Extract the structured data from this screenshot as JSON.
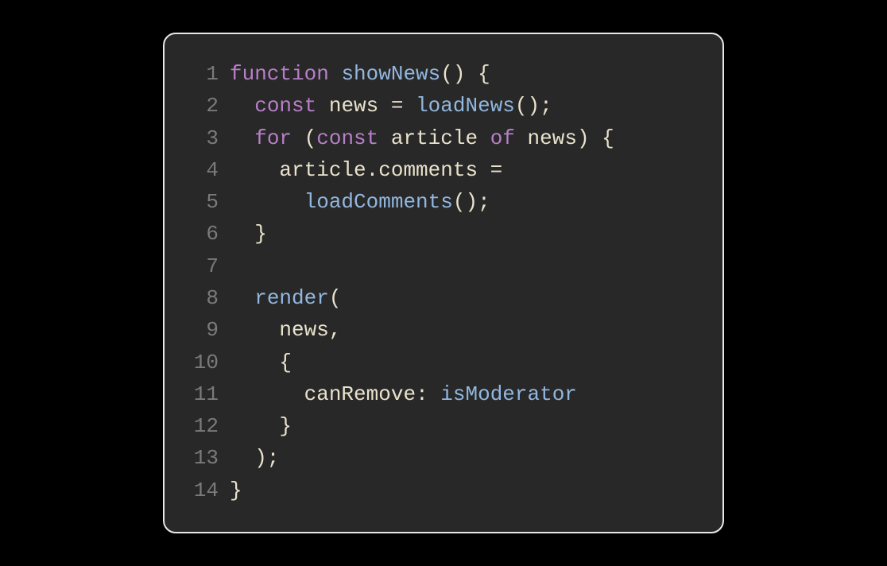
{
  "code": {
    "lines": [
      {
        "num": "1",
        "tokens": [
          {
            "cls": "tk-keyword",
            "text": "function"
          },
          {
            "cls": "tk-punc",
            "text": " "
          },
          {
            "cls": "tk-funcdef",
            "text": "showNews"
          },
          {
            "cls": "tk-punc",
            "text": "() {"
          }
        ]
      },
      {
        "num": "2",
        "tokens": [
          {
            "cls": "tk-punc",
            "text": "  "
          },
          {
            "cls": "tk-keyword",
            "text": "const"
          },
          {
            "cls": "tk-punc",
            "text": " "
          },
          {
            "cls": "tk-var",
            "text": "news"
          },
          {
            "cls": "tk-punc",
            "text": " = "
          },
          {
            "cls": "tk-funccall",
            "text": "loadNews"
          },
          {
            "cls": "tk-punc",
            "text": "();"
          }
        ]
      },
      {
        "num": "3",
        "tokens": [
          {
            "cls": "tk-punc",
            "text": "  "
          },
          {
            "cls": "tk-keyword",
            "text": "for"
          },
          {
            "cls": "tk-punc",
            "text": " ("
          },
          {
            "cls": "tk-keyword",
            "text": "const"
          },
          {
            "cls": "tk-punc",
            "text": " "
          },
          {
            "cls": "tk-var",
            "text": "article"
          },
          {
            "cls": "tk-punc",
            "text": " "
          },
          {
            "cls": "tk-keyword",
            "text": "of"
          },
          {
            "cls": "tk-punc",
            "text": " "
          },
          {
            "cls": "tk-var",
            "text": "news"
          },
          {
            "cls": "tk-punc",
            "text": ") {"
          }
        ]
      },
      {
        "num": "4",
        "tokens": [
          {
            "cls": "tk-punc",
            "text": "    "
          },
          {
            "cls": "tk-var",
            "text": "article"
          },
          {
            "cls": "tk-punc",
            "text": "."
          },
          {
            "cls": "tk-prop",
            "text": "comments"
          },
          {
            "cls": "tk-punc",
            "text": " ="
          }
        ]
      },
      {
        "num": "5",
        "tokens": [
          {
            "cls": "tk-punc",
            "text": "      "
          },
          {
            "cls": "tk-funccall",
            "text": "loadComments"
          },
          {
            "cls": "tk-punc",
            "text": "();"
          }
        ]
      },
      {
        "num": "6",
        "tokens": [
          {
            "cls": "tk-punc",
            "text": "  }"
          }
        ]
      },
      {
        "num": "7",
        "tokens": []
      },
      {
        "num": "8",
        "tokens": [
          {
            "cls": "tk-punc",
            "text": "  "
          },
          {
            "cls": "tk-funccall",
            "text": "render"
          },
          {
            "cls": "tk-punc",
            "text": "("
          }
        ]
      },
      {
        "num": "9",
        "tokens": [
          {
            "cls": "tk-punc",
            "text": "    "
          },
          {
            "cls": "tk-var",
            "text": "news"
          },
          {
            "cls": "tk-punc",
            "text": ","
          }
        ]
      },
      {
        "num": "10",
        "tokens": [
          {
            "cls": "tk-punc",
            "text": "    {"
          }
        ]
      },
      {
        "num": "11",
        "tokens": [
          {
            "cls": "tk-punc",
            "text": "      "
          },
          {
            "cls": "tk-prop",
            "text": "canRemove"
          },
          {
            "cls": "tk-punc",
            "text": ": "
          },
          {
            "cls": "tk-funccall",
            "text": "isModerator"
          }
        ]
      },
      {
        "num": "12",
        "tokens": [
          {
            "cls": "tk-punc",
            "text": "    }"
          }
        ]
      },
      {
        "num": "13",
        "tokens": [
          {
            "cls": "tk-punc",
            "text": "  );"
          }
        ]
      },
      {
        "num": "14",
        "tokens": [
          {
            "cls": "tk-punc",
            "text": "}"
          }
        ]
      }
    ]
  }
}
